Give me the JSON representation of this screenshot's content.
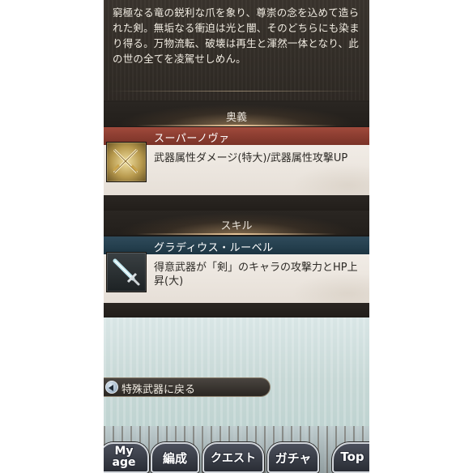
{
  "description": {
    "text": "窮極なる竜の鋭利な爪を象り、尊崇の念を込めて造られた剣。無垢なる衝迫は光と闇、そのどちらにも染まり得る。万物流転、破壊は再生と渾然一体となり、此の世の全てを凌駕せしめん。"
  },
  "ougi": {
    "section_title": "奥義",
    "name": "スーパーノヴァ",
    "effect": "武器属性ダメージ(特大)/武器属性攻撃UP",
    "icon": "crossed-swords-icon"
  },
  "skill": {
    "section_title": "スキル",
    "name": "グラディウス・ルーベル",
    "effect": "得意武器が「剣」のキャラの攻撃力とHP上昇(大)",
    "icon": "sword-icon"
  },
  "back_button": {
    "label": "特殊武器に戻る",
    "icon": "arrow-left-icon"
  },
  "nav": {
    "mypage_line1": "My",
    "mypage_line2": "age",
    "formation": "編成",
    "quest": "クエスト",
    "gacha": "ガチャ",
    "top": "Top"
  },
  "colors": {
    "ougi_bar": "#8a3c30",
    "skill_bar": "#25404f",
    "card_body": "#ece6de",
    "panel_dark": "#2e2924"
  }
}
